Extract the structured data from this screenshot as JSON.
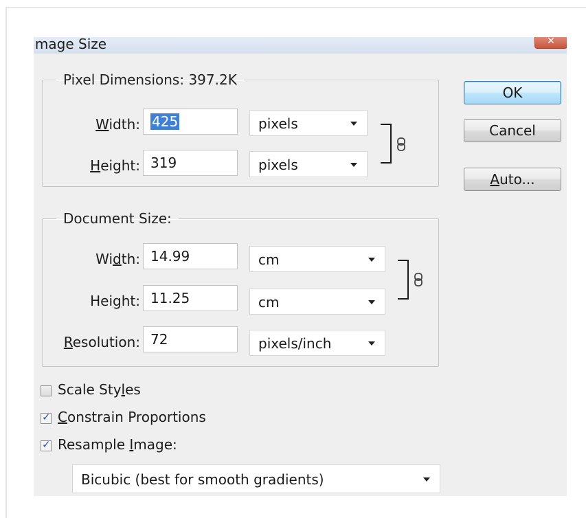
{
  "dialog": {
    "title": "Image Size",
    "close_glyph": "✕",
    "close_icon": "close-icon"
  },
  "pixel_dimensions": {
    "legend": "Pixel Dimensions:  397.2K",
    "width": {
      "label_pre": "",
      "label_mnemonic": "W",
      "label_post": "idth:",
      "value": "425",
      "unit": "pixels"
    },
    "height": {
      "label_pre": "",
      "label_mnemonic": "H",
      "label_post": "eight:",
      "value": "319",
      "unit": "pixels"
    },
    "link_icon": "chain-link-icon"
  },
  "document_size": {
    "legend": "Document Size:",
    "width": {
      "label_pre": "Wi",
      "label_mnemonic": "d",
      "label_post": "th:",
      "value": "14.99",
      "unit": "cm"
    },
    "height": {
      "label_pre": "Hei",
      "label_mnemonic": "g",
      "label_post": "ht:",
      "value": "11.25",
      "unit": "cm"
    },
    "resolution": {
      "label_pre": "",
      "label_mnemonic": "R",
      "label_post": "esolution:",
      "value": "72",
      "unit": "pixels/inch"
    },
    "link_icon": "chain-link-icon"
  },
  "buttons": {
    "ok": "OK",
    "cancel": "Cancel",
    "auto_mnemonic": "A",
    "auto_rest": "uto..."
  },
  "options": {
    "scale_styles": {
      "pre": "Scale Sty",
      "mnemonic": "l",
      "post": "es",
      "checked": false
    },
    "constrain": {
      "pre": "",
      "mnemonic": "C",
      "post": "onstrain Proportions",
      "checked": true
    },
    "resample": {
      "pre": "Resample ",
      "mnemonic": "I",
      "post": "mage:",
      "checked": true
    },
    "check_glyph": "✓"
  },
  "resample_method": {
    "selected": "Bicubic (best for smooth gradients)"
  },
  "colors": {
    "accent": "#3f80d6",
    "default_button_border": "#3c7fb1",
    "close_button": "#c7553f"
  }
}
